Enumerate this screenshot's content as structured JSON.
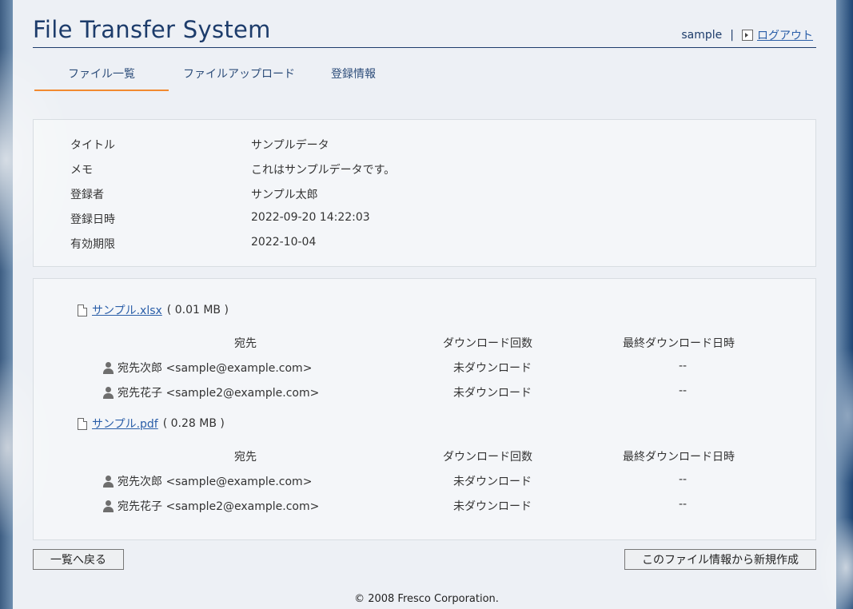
{
  "header": {
    "app_title": "File Transfer System",
    "username": "sample",
    "separator": "|",
    "logout_label": "ログアウト"
  },
  "tabs": [
    {
      "label": "ファイル一覧",
      "active": true
    },
    {
      "label": "ファイルアップロード",
      "active": false
    },
    {
      "label": "登録情報",
      "active": false
    }
  ],
  "info": [
    {
      "label": "タイトル",
      "value": "サンプルデータ"
    },
    {
      "label": "メモ",
      "value": "これはサンプルデータです。"
    },
    {
      "label": "登録者",
      "value": "サンプル太郎"
    },
    {
      "label": "登録日時",
      "value": "2022-09-20 14:22:03"
    },
    {
      "label": "有効期限",
      "value": "2022-10-04"
    }
  ],
  "columns": {
    "recipient": "宛先",
    "download_count": "ダウンロード回数",
    "last_download": "最終ダウンロード日時"
  },
  "files": [
    {
      "name": "サンプル.xlsx",
      "size": "( 0.01 MB )",
      "recipients": [
        {
          "name": "宛先次郎 <sample@example.com>",
          "count": "未ダウンロード",
          "last": "--"
        },
        {
          "name": "宛先花子 <sample2@example.com>",
          "count": "未ダウンロード",
          "last": "--"
        }
      ]
    },
    {
      "name": "サンプル.pdf",
      "size": "( 0.28 MB )",
      "recipients": [
        {
          "name": "宛先次郎 <sample@example.com>",
          "count": "未ダウンロード",
          "last": "--"
        },
        {
          "name": "宛先花子 <sample2@example.com>",
          "count": "未ダウンロード",
          "last": "--"
        }
      ]
    }
  ],
  "buttons": {
    "back": "一覧へ戻る",
    "new_from": "このファイル情報から新規作成"
  },
  "footer": "© 2008 Fresco Corporation.",
  "colors": {
    "accent": "#f28a30",
    "title": "#1d3c6b",
    "link": "#2a5ea8"
  },
  "icons": [
    "logout-icon",
    "file-icon",
    "person-icon"
  ]
}
